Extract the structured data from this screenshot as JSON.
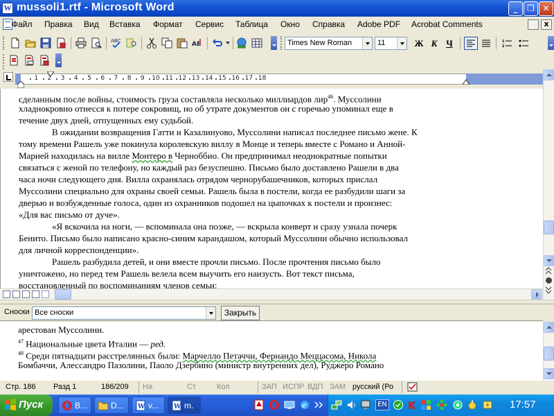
{
  "window": {
    "title": "mussoli1.rtf - Microsoft Word",
    "minimize_glyph": "_",
    "maximize_glyph": "❐",
    "close_glyph": "✕",
    "icon_letter": "W"
  },
  "menu": {
    "items": [
      "Файл",
      "Правка",
      "Вид",
      "Вставка",
      "Формат",
      "Сервис",
      "Таблица",
      "Окно",
      "Справка",
      "Adobe PDF",
      "Acrobat Comments"
    ],
    "close_glyph": "x"
  },
  "formatting": {
    "font_name": "Times New Roman",
    "font_size": "11",
    "bold_label": "Ж",
    "italic_label": "К",
    "underline_label": "Ч"
  },
  "ruler": {
    "numbers": [
      "1",
      "2",
      "3",
      "4",
      "5",
      "6",
      "7",
      "8",
      "9",
      "10",
      "11",
      "12",
      "13",
      "14",
      "15",
      "16",
      "17",
      "18"
    ]
  },
  "document": {
    "lines": [
      {
        "text": "сделанным после войны, стоимость груза составляла несколько миллиардов лир",
        "sup": "46",
        "after": ". Муссолини"
      },
      {
        "text": "хладнокровно отнесся к потере сокровищ, но об утрате документов он с горечью упоминал еще в"
      },
      {
        "text": "течение двух дней, отпущенных ему судьбой."
      },
      {
        "text": "В ожидании возвращения Гатти и Казалинуово, Муссолини написал последнее письмо жене. К",
        "indent": true
      },
      {
        "text": "тому времени Рашель уже покинула королевскую виллу в Монце и теперь вместе с Романо и Анной-"
      },
      {
        "text": "Марией находилась на вилле ",
        "wavy": "Монтеро в",
        "after": " Черноббио. Он предпринимал неоднократные попытки"
      },
      {
        "text": "связаться с женой по телефону, но каждый раз безуспешно. Письмо было доставлено Рашели в два"
      },
      {
        "text": "часа ночи следующего дня. Вилла охранялась отрядом чернорубашечников, которых прислал"
      },
      {
        "text": "Муссолини специально для охраны своей семьи. Рашель была в постели, когда ее разбудили шаги за"
      },
      {
        "text": "дверью и возбужденные голоса, один из охранников подошел на цыпочках к постели и произнес:"
      },
      {
        "text": "«Для вас письмо от дуче»."
      },
      {
        "text": "«Я вскочила на ноги, — вспоминала она позже, — вскрыла конверт и сразу узнала почерк",
        "indent": true
      },
      {
        "text": "Бенито. Письмо было написано красно-синим карандашом, который Муссолини обычно использовал"
      },
      {
        "text": "для личной корреспонденции»."
      },
      {
        "text": "Рашель разбудила детей, и они вместе прочли письмо. После прочтения письмо было",
        "indent": true
      },
      {
        "text": "уничтожено, но перед тем Рашель велела всем выучить его наизусть. Вот текст письма,"
      },
      {
        "text": "восстановленный по воспоминаниям членов семьи:"
      }
    ]
  },
  "footnote_bar": {
    "label": "Сноски",
    "selected": "Все сноски",
    "close_label": "Закрыть"
  },
  "footnotes": {
    "line1": "арестован Муссолини.",
    "fn47_num": "47",
    "fn47_text": " Национальные цвета Италии — ",
    "fn47_italic": "ред.",
    "fn48_num": "48",
    "fn48_text": " Среди пятнадцати расстрелянных были: ",
    "fn48_wavy": "Марчелло Петаччи, Фернандо Меццасома, Никола",
    "line4": "Бомбаччи, Алессандро Пазолини, Паоло Дзербино (министр внутренних дел), Руджеро Романо"
  },
  "status": {
    "page": "Стр.  186",
    "section": "Разд  1",
    "pages": "186/209",
    "at": "На",
    "line": "Ст",
    "col": "Кол",
    "rec": "ЗАП",
    "trk": "ИСПР",
    "ext": "ВДП",
    "ovr": "ЗАМ",
    "language": "русский (Ро"
  },
  "taskbar": {
    "start_label": "Пуск",
    "tasks": [
      {
        "label": "В..."
      },
      {
        "label": "D..."
      },
      {
        "label": "v..."
      },
      {
        "label": "m."
      }
    ],
    "lang": "EN",
    "clock": "17:57"
  },
  "colors": {
    "titlebar": "#0a46c4",
    "taskbar": "#245ed9",
    "start_button": "#3a9a2d",
    "tray": "#0e87dd",
    "spell_underline": "#3aa23a"
  }
}
